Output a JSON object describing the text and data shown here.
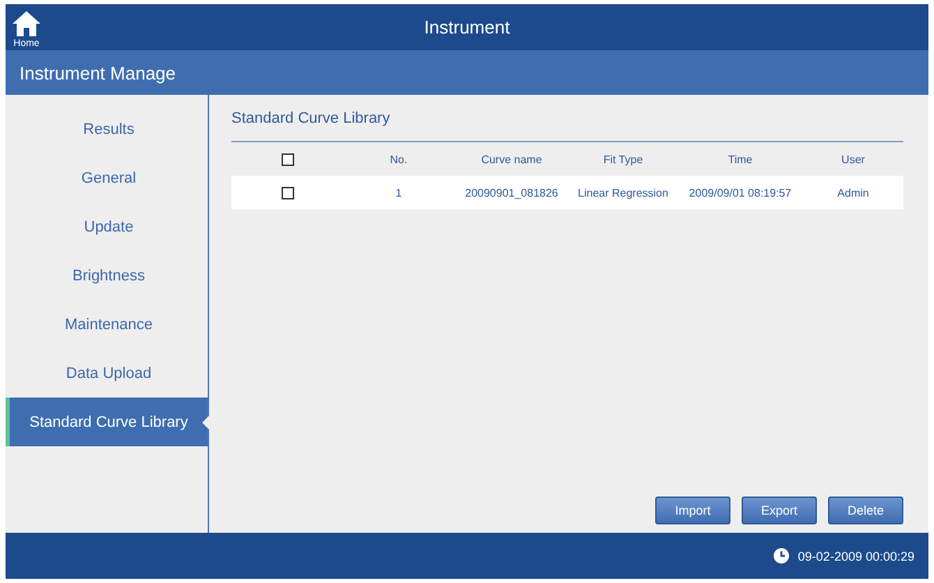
{
  "header": {
    "home_label": "Home",
    "title": "Instrument"
  },
  "section_title": "Instrument Manage",
  "sidebar": {
    "items": [
      {
        "label": "Results",
        "selected": false
      },
      {
        "label": "General",
        "selected": false
      },
      {
        "label": "Update",
        "selected": false
      },
      {
        "label": "Brightness",
        "selected": false
      },
      {
        "label": "Maintenance",
        "selected": false
      },
      {
        "label": "Data Upload",
        "selected": false
      },
      {
        "label": "Standard Curve Library",
        "selected": true
      }
    ]
  },
  "content": {
    "title": "Standard Curve Library",
    "table": {
      "select_all_checked": false,
      "columns": [
        "No.",
        "Curve name",
        "Fit Type",
        "Time",
        "User"
      ],
      "rows": [
        {
          "checked": false,
          "cells": [
            "1",
            "20090901_081826",
            "Linear Regression",
            "2009/09/01 08:19:57",
            "Admin"
          ]
        }
      ]
    },
    "buttons": [
      "Import",
      "Export",
      "Delete"
    ]
  },
  "status_bar": {
    "datetime": "09-02-2009 00:00:29"
  }
}
